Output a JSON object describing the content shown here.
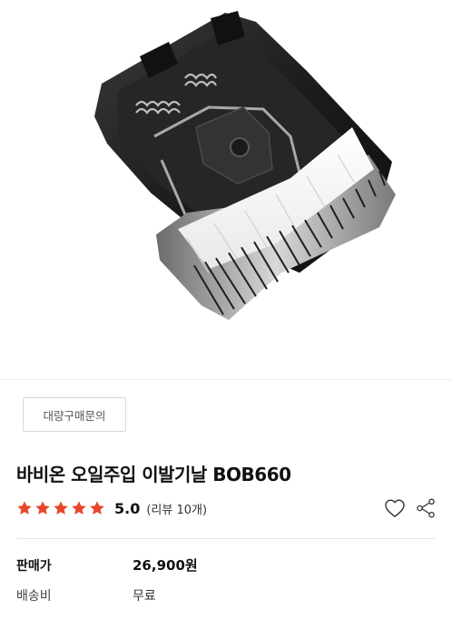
{
  "product": {
    "bulk_inquiry_label": "대량구매문의",
    "title": "바비온 오일주입 이발기날 BOB660",
    "rating": {
      "stars_filled": 5,
      "stars_total": 5,
      "score": "5.0",
      "review_count": "(리뷰 10개)"
    },
    "image_alt": "BOB660 trimmer blade"
  },
  "actions": {
    "wishlist_icon": "heart-outline-icon",
    "share_icon": "share-icon"
  },
  "info": {
    "price_label": "판매가",
    "price_value": "26,900원",
    "shipping_label": "배송비",
    "shipping_value": "무료"
  },
  "colors": {
    "star": "#e8472c",
    "text": "#111111",
    "divider": "#e6e6e6",
    "button_border": "#d9d9d9"
  }
}
